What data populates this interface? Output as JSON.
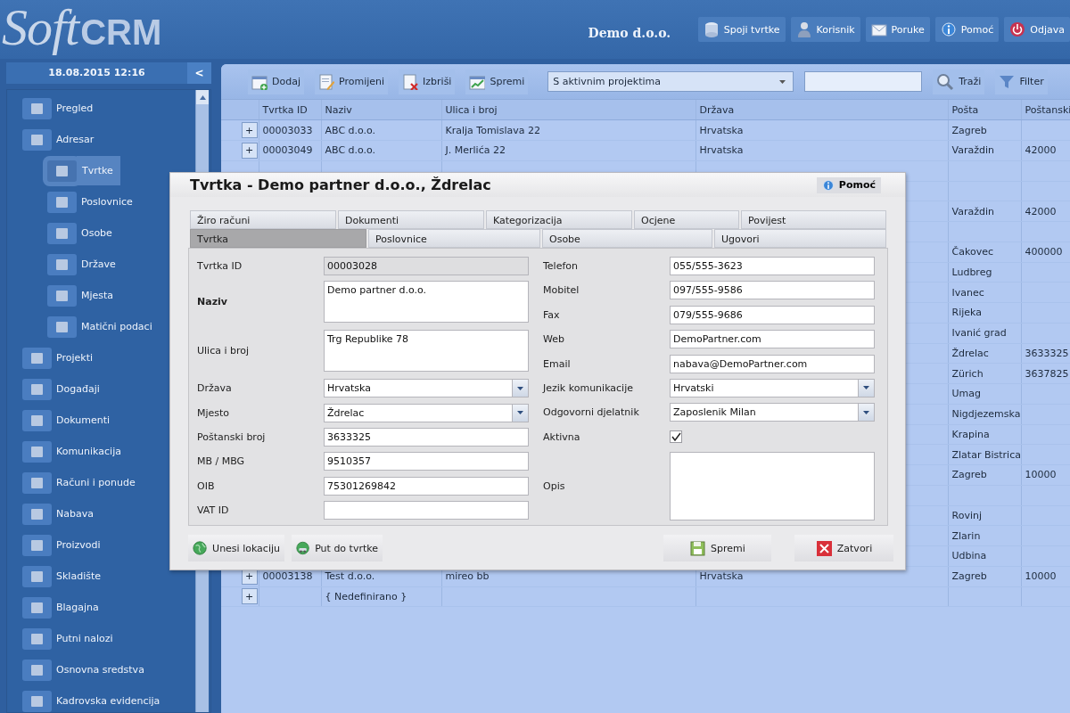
{
  "header": {
    "logo_soft": "Soft",
    "logo_crm": "CRM",
    "company": "Demo d.o.o.",
    "buttons": [
      {
        "label": "Spoji tvrtke",
        "kind": "merge"
      },
      {
        "label": "Korisnik",
        "kind": "user"
      },
      {
        "label": "Poruke",
        "kind": "mail"
      },
      {
        "label": "Pomoć",
        "kind": "help"
      },
      {
        "label": "Odjava",
        "kind": "logout"
      }
    ]
  },
  "sidebar": {
    "datetime": "18.08.2015 12:16",
    "collapse": "<",
    "items": [
      {
        "label": "Pregled",
        "selected": false
      },
      {
        "label": "Adresar",
        "selected": false,
        "children": [
          {
            "label": "Tvrtke",
            "selected": true
          },
          {
            "label": "Poslovnice",
            "selected": false
          },
          {
            "label": "Osobe",
            "selected": false
          },
          {
            "label": "Države",
            "selected": false
          },
          {
            "label": "Mjesta",
            "selected": false
          },
          {
            "label": "Matični podaci",
            "selected": false
          }
        ]
      },
      {
        "label": "Projekti",
        "selected": false
      },
      {
        "label": "Događaji",
        "selected": false
      },
      {
        "label": "Dokumenti",
        "selected": false
      },
      {
        "label": "Komunikacija",
        "selected": false
      },
      {
        "label": "Računi i ponude",
        "selected": false
      },
      {
        "label": "Nabava",
        "selected": false
      },
      {
        "label": "Proizvodi",
        "selected": false
      },
      {
        "label": "Skladište",
        "selected": false
      },
      {
        "label": "Blagajna",
        "selected": false
      },
      {
        "label": "Putni nalozi",
        "selected": false
      },
      {
        "label": "Osnovna sredstva",
        "selected": false
      },
      {
        "label": "Kadrovska evidencija",
        "selected": false
      }
    ]
  },
  "toolbar": {
    "buttons": [
      {
        "label": "Dodaj",
        "kind": "add"
      },
      {
        "label": "Promijeni",
        "kind": "edit"
      },
      {
        "label": "Izbriši",
        "kind": "delete"
      },
      {
        "label": "Spremi",
        "kind": "save"
      }
    ],
    "filter_select": "S aktivnim projektima",
    "search_button": "Traži",
    "filter_button": "Filter"
  },
  "table": {
    "columns": [
      "Tvrtka ID",
      "Naziv",
      "Ulica i broj",
      "Država",
      "Pošta",
      "Poštanski"
    ],
    "rows": [
      {
        "expand": "+",
        "cells": [
          "00003033",
          "ABC d.o.o.",
          "Kralja Tomislava 22",
          "Hrvatska",
          "Zagreb",
          null
        ]
      },
      {
        "expand": "+",
        "cells": [
          "00003049",
          "ABC d.o.o.",
          "J. Merlića 22",
          "Hrvatska",
          "Varaždin",
          "42000"
        ]
      },
      {
        "cells": [
          null,
          null,
          null,
          null,
          null,
          null
        ]
      },
      {
        "cells": [
          null,
          null,
          null,
          null,
          null,
          null
        ]
      },
      {
        "cells": [
          null,
          null,
          null,
          null,
          "Varaždin",
          "42000"
        ]
      },
      {
        "cells": [
          null,
          null,
          null,
          null,
          null,
          null
        ]
      },
      {
        "cells": [
          null,
          null,
          null,
          null,
          "Čakovec",
          "400000"
        ]
      },
      {
        "cells": [
          null,
          null,
          null,
          null,
          "Ludbreg",
          null
        ]
      },
      {
        "cells": [
          null,
          null,
          null,
          null,
          "Ivanec",
          null
        ]
      },
      {
        "cells": [
          null,
          null,
          null,
          null,
          "Rijeka",
          null
        ]
      },
      {
        "cells": [
          null,
          null,
          null,
          null,
          "Ivanić grad",
          null
        ]
      },
      {
        "cells": [
          null,
          null,
          null,
          null,
          "Ždrelac",
          "3633325"
        ]
      },
      {
        "cells": [
          null,
          null,
          null,
          null,
          "Zürich",
          "3637825"
        ]
      },
      {
        "cells": [
          null,
          null,
          null,
          null,
          "Umag",
          null
        ]
      },
      {
        "cells": [
          null,
          null,
          null,
          null,
          "Nigdjezemska",
          null
        ]
      },
      {
        "cells": [
          null,
          null,
          null,
          null,
          "Krapina",
          null
        ]
      },
      {
        "cells": [
          null,
          null,
          null,
          null,
          "Zlatar Bistrica",
          null
        ]
      },
      {
        "cells": [
          null,
          null,
          null,
          null,
          "Zagreb",
          "10000"
        ]
      },
      {
        "cells": [
          null,
          null,
          null,
          null,
          null,
          null
        ]
      },
      {
        "cells": [
          null,
          null,
          null,
          null,
          "Rovinj",
          null
        ]
      },
      {
        "cells": [
          null,
          null,
          null,
          null,
          "Zlarin",
          null
        ]
      },
      {
        "cells": [
          null,
          null,
          null,
          null,
          "Udbina",
          null
        ]
      },
      {
        "expand": "+",
        "cells": [
          "00003138",
          "Test d.o.o.",
          "mireo bb",
          "Hrvatska",
          "Zagreb",
          "10000"
        ]
      },
      {
        "expand": "+",
        "cells": [
          null,
          "{ Nedefinirano }",
          null,
          null,
          null,
          null
        ]
      }
    ]
  },
  "dialog": {
    "title": "Tvrtka - Demo partner d.o.o., Ždrelac",
    "help_button": "Pomoć",
    "tab_rows": [
      [
        {
          "label": "Žiro računi",
          "selected": false
        },
        {
          "label": "Dokumenti",
          "selected": false
        },
        {
          "label": "Kategorizacija",
          "selected": false
        },
        {
          "label": "Ocjene",
          "selected": false
        },
        {
          "label": "Povijest",
          "selected": false
        }
      ],
      [
        {
          "label": "Tvrtka",
          "selected": true
        },
        {
          "label": "Poslovnice",
          "selected": false
        },
        {
          "label": "Osobe",
          "selected": false
        },
        {
          "label": "Ugovori",
          "selected": false
        }
      ]
    ],
    "left_fields": [
      {
        "label": "Tvrtka ID",
        "kind": "text",
        "value": "00003028",
        "readonly": true,
        "required": false
      },
      {
        "label": "Naziv",
        "kind": "textarea",
        "value": "Demo partner d.o.o.",
        "readonly": false,
        "required": true
      },
      {
        "label": "Ulica i broj",
        "kind": "textarea",
        "value": "Trg Republike 78",
        "readonly": false,
        "required": false
      },
      {
        "label": "Država",
        "kind": "select",
        "value": "Hrvatska",
        "readonly": false,
        "required": false
      },
      {
        "label": "Mjesto",
        "kind": "select",
        "value": "Ždrelac",
        "readonly": false,
        "required": false
      },
      {
        "label": "Poštanski broj",
        "kind": "text",
        "value": "3633325",
        "readonly": false,
        "required": false
      },
      {
        "label": "MB / MBG",
        "kind": "text",
        "value": "9510357",
        "readonly": false,
        "required": false
      },
      {
        "label": "OIB",
        "kind": "text",
        "value": "75301269842",
        "readonly": false,
        "required": false
      },
      {
        "label": "VAT ID",
        "kind": "text",
        "readonly": false,
        "required": false
      }
    ],
    "right_fields": [
      {
        "label": "Telefon",
        "kind": "text",
        "value": "055/555-3623"
      },
      {
        "label": "Mobitel",
        "kind": "text",
        "value": "097/555-9586"
      },
      {
        "label": "Fax",
        "kind": "text",
        "value": "079/555-9686"
      },
      {
        "label": "Web",
        "kind": "text",
        "value": "DemoPartner.com"
      },
      {
        "label": "Email",
        "kind": "text",
        "value": "nabava@DemoPartner.com"
      },
      {
        "label": "Jezik komunikacije",
        "kind": "select",
        "value": "Hrvatski"
      },
      {
        "label": "Odgovorni djelatnik",
        "kind": "select",
        "value": "Zaposlenik Milan"
      },
      {
        "label": "Aktivna",
        "kind": "checkbox",
        "checked": true
      },
      {
        "label": "Opis",
        "kind": "memo"
      }
    ],
    "actions": [
      {
        "label": "Unesi lokaciju",
        "kind": "location"
      },
      {
        "label": "Put do tvrtke",
        "kind": "route"
      },
      {
        "label": "Spremi",
        "kind": "save"
      },
      {
        "label": "Zatvori",
        "kind": "close"
      }
    ]
  }
}
